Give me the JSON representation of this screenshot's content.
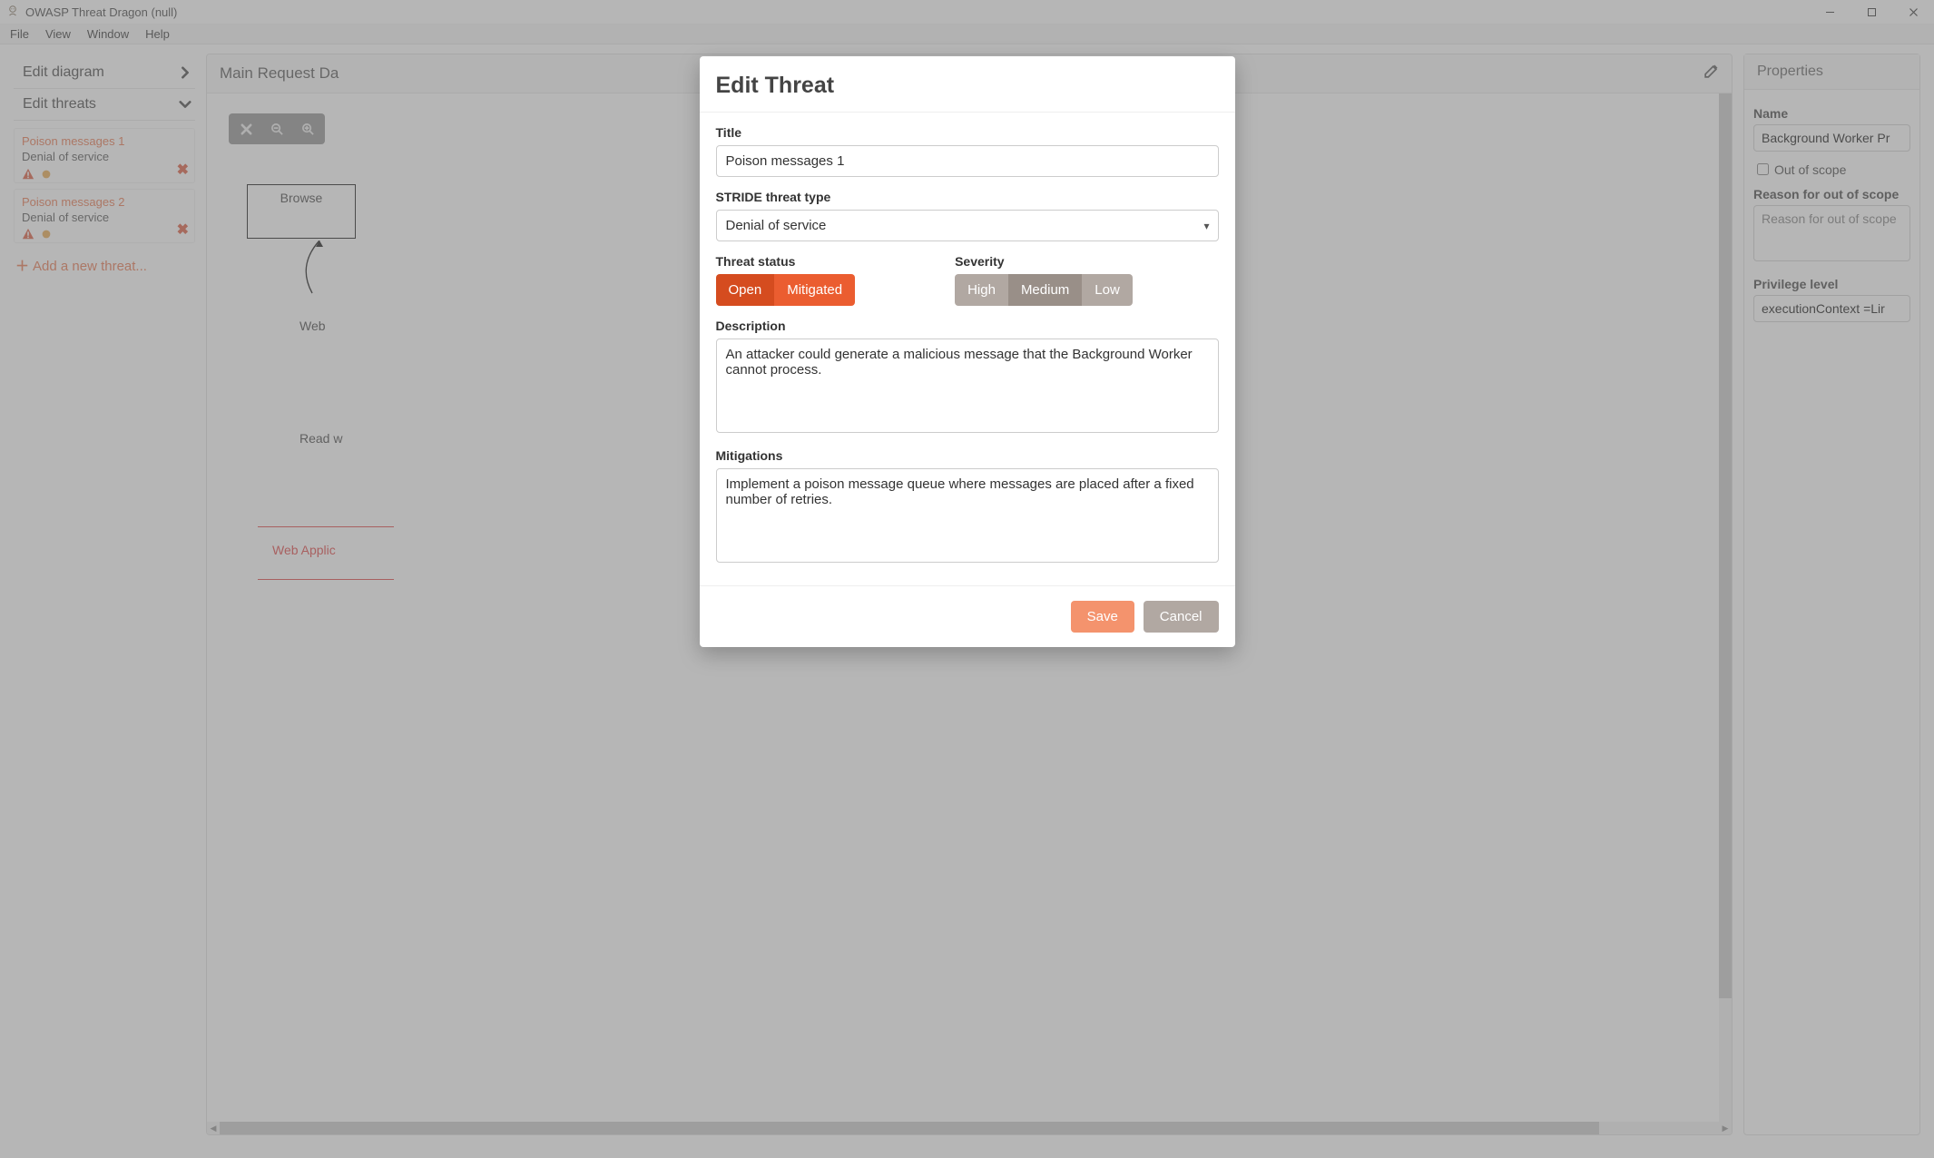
{
  "window": {
    "title": "OWASP Threat Dragon (null)"
  },
  "menu": {
    "items": [
      "File",
      "View",
      "Window",
      "Help"
    ]
  },
  "left": {
    "edit_diagram": "Edit diagram",
    "edit_threats": "Edit threats",
    "threats": [
      {
        "title": "Poison messages 1",
        "type": "Denial of service"
      },
      {
        "title": "Poison messages 2",
        "type": "Denial of service"
      }
    ],
    "add_threat": "Add a new threat..."
  },
  "center": {
    "title": "Main Request Da",
    "nodes": {
      "browser": "Browse"
    },
    "flow_labels": {
      "web": "Web",
      "read": "Read w"
    },
    "boundary": {
      "label": "Web Applic"
    }
  },
  "right": {
    "header": "Properties",
    "name_label": "Name",
    "name_value": "Background Worker Pr",
    "out_of_scope_label": "Out of scope",
    "reason_label": "Reason for out of scope",
    "reason_placeholder": "Reason for out of scope",
    "privilege_label": "Privilege level",
    "privilege_value": "executionContext =Lir"
  },
  "modal": {
    "header": "Edit Threat",
    "title_label": "Title",
    "title_value": "Poison messages 1",
    "stride_label": "STRIDE threat type",
    "stride_value": "Denial of service",
    "status_label": "Threat status",
    "status_options": [
      "Open",
      "Mitigated"
    ],
    "status_selected": "Open",
    "severity_label": "Severity",
    "severity_options": [
      "High",
      "Medium",
      "Low"
    ],
    "severity_selected": "Medium",
    "description_label": "Description",
    "description_value": "An attacker could generate a malicious message that the Background Worker cannot process.",
    "mitigations_label": "Mitigations",
    "mitigations_value": "Implement a poison message queue where messages are placed after a fixed number of retries.",
    "save": "Save",
    "cancel": "Cancel"
  }
}
